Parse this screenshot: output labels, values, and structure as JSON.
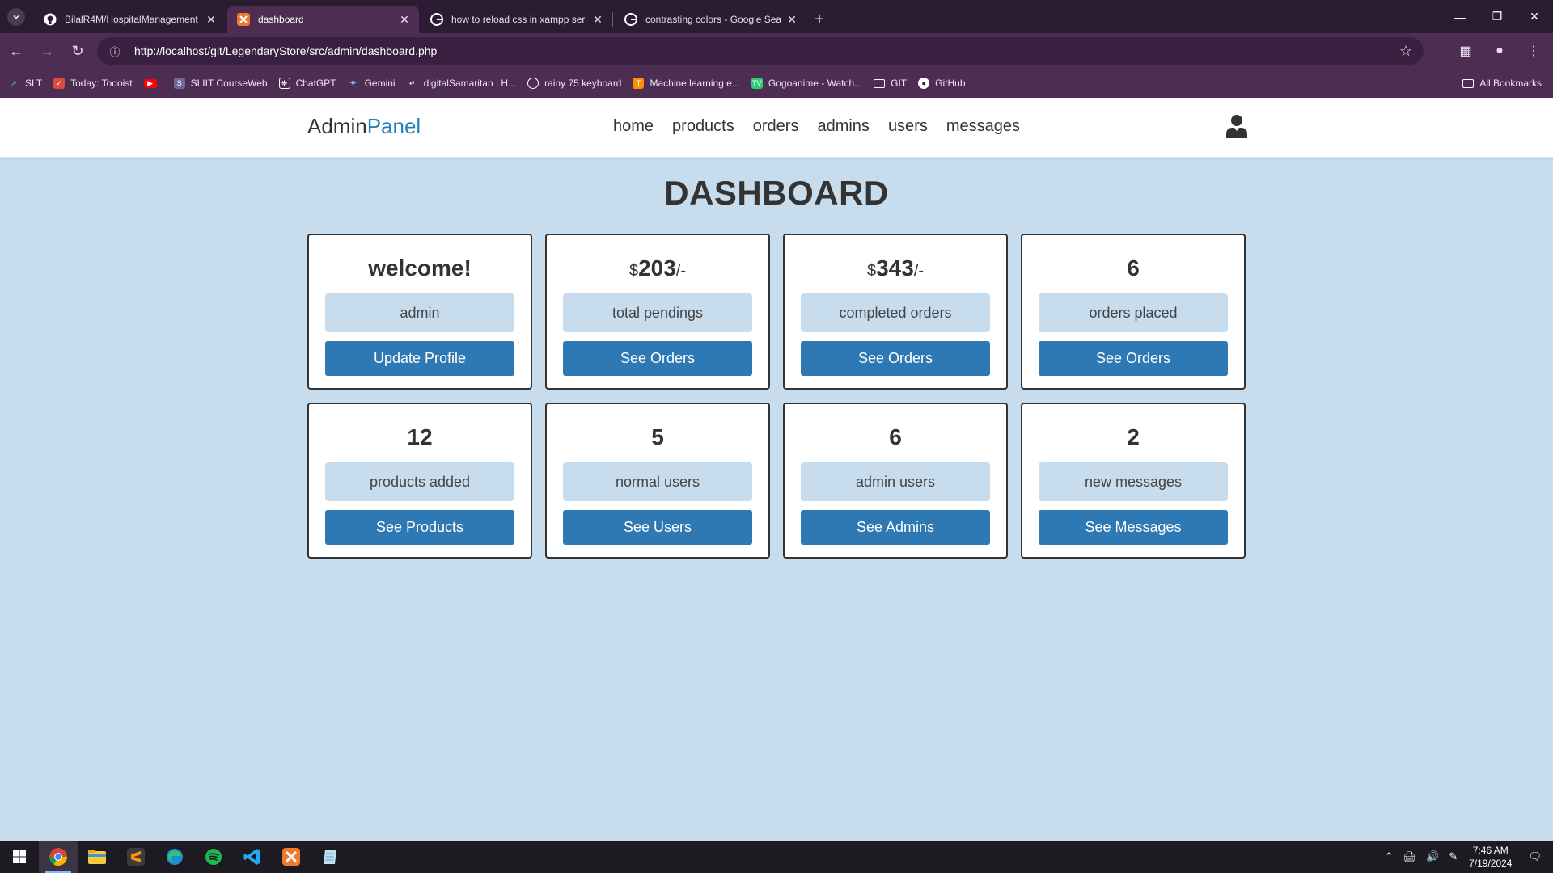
{
  "browser": {
    "tabs": [
      {
        "title": "BilalR4M/HospitalManagement",
        "active": false
      },
      {
        "title": "dashboard",
        "active": true
      },
      {
        "title": "how to reload css in xampp ser",
        "active": false
      },
      {
        "title": "contrasting colors - Google Sea",
        "active": false
      }
    ],
    "url": "http://localhost/git/LegendaryStore/src/admin/dashboard.php",
    "bookmarks": [
      "SLT",
      "Today: Todoist",
      "",
      "SLIIT CourseWeb",
      "ChatGPT",
      "Gemini",
      "digitalSamaritan | H...",
      "rainy 75 keyboard",
      "Machine learning e...",
      "Gogoanime - Watch...",
      "GIT",
      "GitHub"
    ],
    "all_bookmarks": "All Bookmarks"
  },
  "header": {
    "logo_main": "Admin",
    "logo_accent": "Panel",
    "nav": [
      "home",
      "products",
      "orders",
      "admins",
      "users",
      "messages"
    ]
  },
  "main": {
    "title": "DASHBOARD",
    "cards": [
      {
        "prefix": "",
        "value": "welcome!",
        "suffix": "",
        "label": "admin",
        "button": "Update Profile"
      },
      {
        "prefix": "$",
        "value": "203",
        "suffix": "/-",
        "label": "total pendings",
        "button": "See Orders"
      },
      {
        "prefix": "$",
        "value": "343",
        "suffix": "/-",
        "label": "completed orders",
        "button": "See Orders"
      },
      {
        "prefix": "",
        "value": "6",
        "suffix": "",
        "label": "orders placed",
        "button": "See Orders"
      },
      {
        "prefix": "",
        "value": "12",
        "suffix": "",
        "label": "products added",
        "button": "See Products"
      },
      {
        "prefix": "",
        "value": "5",
        "suffix": "",
        "label": "normal users",
        "button": "See Users"
      },
      {
        "prefix": "",
        "value": "6",
        "suffix": "",
        "label": "admin users",
        "button": "See Admins"
      },
      {
        "prefix": "",
        "value": "2",
        "suffix": "",
        "label": "new messages",
        "button": "See Messages"
      }
    ]
  },
  "taskbar": {
    "time": "7:46 AM",
    "date": "7/19/2024"
  },
  "colors": {
    "page_bg": "#c7dcec",
    "accent": "#2980b9",
    "button": "#2e79b4",
    "chrome": "#4e2d52"
  }
}
